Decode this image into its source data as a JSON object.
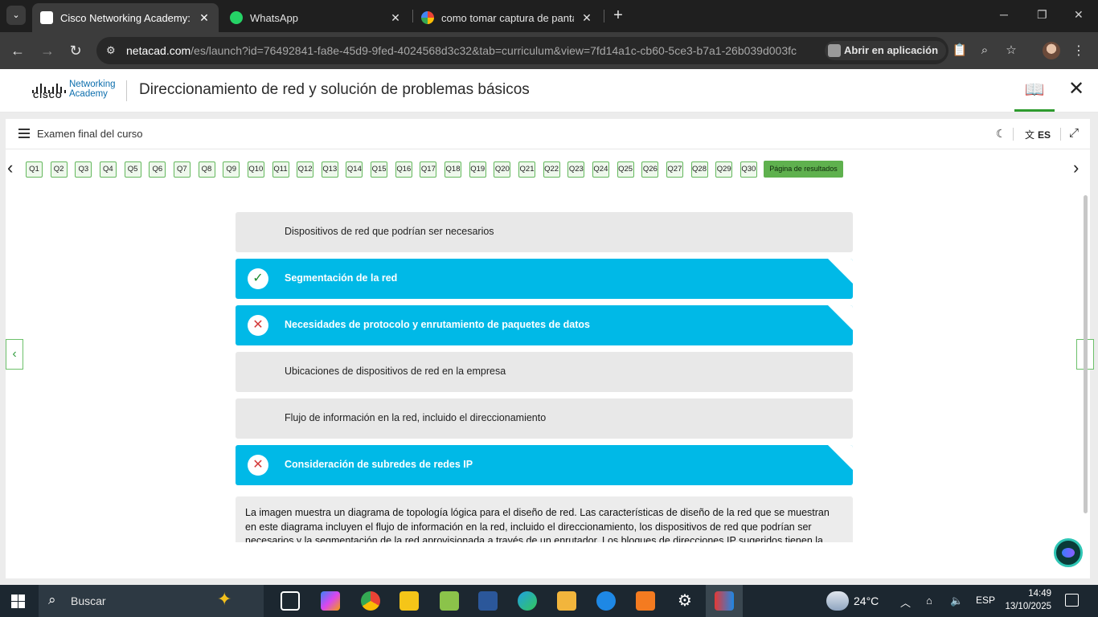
{
  "browser": {
    "tabs": [
      {
        "title": "Cisco Networking Academy: Dire",
        "active": true
      },
      {
        "title": "WhatsApp",
        "active": false
      },
      {
        "title": "como tomar captura de pantalla",
        "active": false
      }
    ],
    "url_host": "netacad.com",
    "url_rest": "/es/launch?id=76492841-fa8e-45d9-9fed-4024568d3c32&tab=curriculum&view=7fd14a1c-cb60-5ce3-b7a1-26b039d003fc",
    "open_app_label": "Abrir en aplicación"
  },
  "header": {
    "logo_line1": "Networking",
    "logo_line2": "Academy",
    "cisco_word": "CISCO",
    "course_title": "Direccionamiento de red y solución de problemas básicos"
  },
  "exam": {
    "title": "Examen final del curso",
    "language": "ES",
    "questions": [
      "Q1",
      "Q2",
      "Q3",
      "Q4",
      "Q5",
      "Q6",
      "Q7",
      "Q8",
      "Q9",
      "Q10",
      "Q11",
      "Q12",
      "Q13",
      "Q14",
      "Q15",
      "Q16",
      "Q17",
      "Q18",
      "Q19",
      "Q20",
      "Q21",
      "Q22",
      "Q23",
      "Q24",
      "Q25",
      "Q26",
      "Q27",
      "Q28",
      "Q29",
      "Q30"
    ],
    "results_label": "Página de resultados"
  },
  "options": [
    {
      "label": "Dispositivos de red que podrían ser necesarios",
      "selected": false,
      "status": "none"
    },
    {
      "label": "Segmentación de la red",
      "selected": true,
      "status": "correct"
    },
    {
      "label": "Necesidades de protocolo y enrutamiento de paquetes de datos",
      "selected": true,
      "status": "incorrect"
    },
    {
      "label": "Ubicaciones de dispositivos de red en la empresa",
      "selected": false,
      "status": "none"
    },
    {
      "label": "Flujo de información en la red, incluido el direccionamiento",
      "selected": false,
      "status": "none"
    },
    {
      "label": "Consideración de subredes de redes IP",
      "selected": true,
      "status": "incorrect"
    }
  ],
  "explanation": "La imagen muestra un diagrama de topología lógica para el diseño de red. Las características de diseño de la red que se muestran en este diagrama incluyen el flujo de información en la red, incluido el direccionamiento, los dispositivos de red que podrían ser necesarios y la segmentación de la red aprovisionada a través de un enrutador. Los bloques de direcciones IP sugeridos tienen la",
  "taskbar": {
    "search_placeholder": "Buscar",
    "weather": "24°C",
    "lang": "ESP",
    "time": "14:49",
    "date": "13/10/2025"
  },
  "colors": {
    "accent": "#00b9e7",
    "correct": "#1d8a2c",
    "incorrect": "#d43a3a",
    "question_ok": "#64b85d",
    "results": "#5fb14e"
  }
}
